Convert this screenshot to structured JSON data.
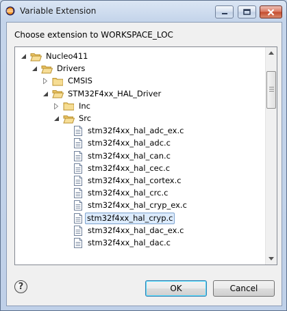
{
  "window": {
    "title": "Variable Extension"
  },
  "dialog": {
    "prompt": "Choose extension to WORKSPACE_LOC",
    "tree": [
      {
        "label": "Nucleo411",
        "type": "folder",
        "depth": 0,
        "expanded": true,
        "selected": false
      },
      {
        "label": "Drivers",
        "type": "folder",
        "depth": 1,
        "expanded": true,
        "selected": false
      },
      {
        "label": "CMSIS",
        "type": "folder",
        "depth": 2,
        "expanded": false,
        "selected": false
      },
      {
        "label": "STM32F4xx_HAL_Driver",
        "type": "folder",
        "depth": 2,
        "expanded": true,
        "selected": false
      },
      {
        "label": "Inc",
        "type": "folder",
        "depth": 3,
        "expanded": false,
        "selected": false
      },
      {
        "label": "Src",
        "type": "folder",
        "depth": 3,
        "expanded": true,
        "selected": false
      },
      {
        "label": "stm32f4xx_hal_adc_ex.c",
        "type": "file",
        "depth": 4,
        "selected": false
      },
      {
        "label": "stm32f4xx_hal_adc.c",
        "type": "file",
        "depth": 4,
        "selected": false
      },
      {
        "label": "stm32f4xx_hal_can.c",
        "type": "file",
        "depth": 4,
        "selected": false
      },
      {
        "label": "stm32f4xx_hal_cec.c",
        "type": "file",
        "depth": 4,
        "selected": false
      },
      {
        "label": "stm32f4xx_hal_cortex.c",
        "type": "file",
        "depth": 4,
        "selected": false
      },
      {
        "label": "stm32f4xx_hal_crc.c",
        "type": "file",
        "depth": 4,
        "selected": false
      },
      {
        "label": "stm32f4xx_hal_cryp_ex.c",
        "type": "file",
        "depth": 4,
        "selected": false
      },
      {
        "label": "stm32f4xx_hal_cryp.c",
        "type": "file",
        "depth": 4,
        "selected": true
      },
      {
        "label": "stm32f4xx_hal_dac_ex.c",
        "type": "file",
        "depth": 4,
        "selected": false
      },
      {
        "label": "stm32f4xx_hal_dac.c",
        "type": "file",
        "depth": 4,
        "selected": false
      }
    ],
    "ok_label": "OK",
    "cancel_label": "Cancel",
    "help_symbol": "?"
  },
  "colors": {
    "selection_bg": "#dcebfc",
    "selection_border": "#7da2ce",
    "folder": "#e8c46a"
  }
}
